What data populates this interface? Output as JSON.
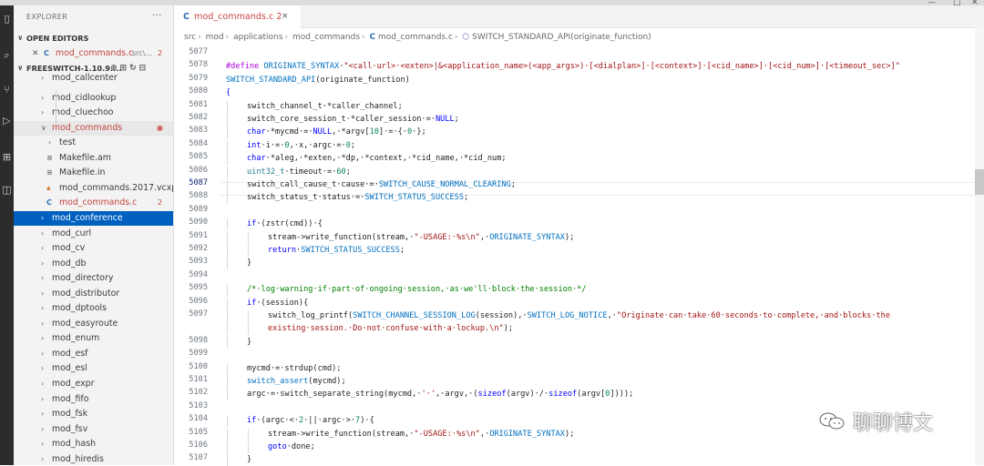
{
  "explorer": {
    "title": "EXPLORER",
    "more": "···",
    "open_editors_label": "OPEN EDITORS",
    "open_editor": {
      "name": "mod_commands.c",
      "path": "src\\...",
      "badge": "2"
    },
    "workspace_label": "FREESWITCH-1.10.9....",
    "tree": [
      {
        "label": "mod_callcenter",
        "indent": 1,
        "type": "folder"
      },
      {
        "label": "mod_cidlookup",
        "indent": 1,
        "type": "folder"
      },
      {
        "label": "mod_cluechoo",
        "indent": 1,
        "type": "folder"
      },
      {
        "label": "mod_commands",
        "indent": 1,
        "type": "folder-open",
        "state": "error"
      },
      {
        "label": "test",
        "indent": 2,
        "type": "folder"
      },
      {
        "label": "Makefile.am",
        "indent": 2,
        "type": "file"
      },
      {
        "label": "Makefile.in",
        "indent": 2,
        "type": "file"
      },
      {
        "label": "mod_commands.2017.vcxp...",
        "indent": 2,
        "type": "vcxproj"
      },
      {
        "label": "mod_commands.c",
        "indent": 2,
        "type": "c",
        "state": "error",
        "badge": "2"
      },
      {
        "label": "mod_conference",
        "indent": 1,
        "type": "folder",
        "state": "selected"
      },
      {
        "label": "mod_curl",
        "indent": 1,
        "type": "folder"
      },
      {
        "label": "mod_cv",
        "indent": 1,
        "type": "folder"
      },
      {
        "label": "mod_db",
        "indent": 1,
        "type": "folder"
      },
      {
        "label": "mod_directory",
        "indent": 1,
        "type": "folder"
      },
      {
        "label": "mod_distributor",
        "indent": 1,
        "type": "folder"
      },
      {
        "label": "mod_dptools",
        "indent": 1,
        "type": "folder"
      },
      {
        "label": "mod_easyroute",
        "indent": 1,
        "type": "folder"
      },
      {
        "label": "mod_enum",
        "indent": 1,
        "type": "folder"
      },
      {
        "label": "mod_esf",
        "indent": 1,
        "type": "folder"
      },
      {
        "label": "mod_esl",
        "indent": 1,
        "type": "folder"
      },
      {
        "label": "mod_expr",
        "indent": 1,
        "type": "folder"
      },
      {
        "label": "mod_fifo",
        "indent": 1,
        "type": "folder"
      },
      {
        "label": "mod_fsk",
        "indent": 1,
        "type": "folder"
      },
      {
        "label": "mod_fsv",
        "indent": 1,
        "type": "folder"
      },
      {
        "label": "mod_hash",
        "indent": 1,
        "type": "folder"
      },
      {
        "label": "mod_hiredis",
        "indent": 1,
        "type": "folder"
      }
    ]
  },
  "tab": {
    "icon": "C",
    "name": "mod_commands.c",
    "badge": "2",
    "close": "×"
  },
  "breadcrumb": [
    "src",
    "mod",
    "applications",
    "mod_commands",
    "mod_commands.c",
    "SWITCH_STANDARD_API(originate_function)"
  ],
  "breadcrumb_c_icon": "C",
  "code": {
    "current_line": "5087",
    "lines": [
      {
        "n": "5077",
        "ind": 0,
        "tokens": []
      },
      {
        "n": "5078",
        "ind": 0,
        "tokens": [
          [
            "pp",
            "#define "
          ],
          [
            "mac",
            "ORIGINATE_SYNTAX"
          ],
          [
            "",
            "·"
          ],
          [
            "str",
            "\"<call·url>·<exten>|&<application_name>(<app_args>)·[<dialplan>]·[<context>]·[<cid_name>]·[<cid_num>]·[<timeout_sec>]\""
          ]
        ]
      },
      {
        "n": "5079",
        "ind": 0,
        "tokens": [
          [
            "mac",
            "SWITCH_STANDARD_API"
          ],
          [
            "",
            "(originate_function)"
          ]
        ]
      },
      {
        "n": "5080",
        "ind": 0,
        "tokens": [
          [
            "kw",
            "{"
          ]
        ]
      },
      {
        "n": "5081",
        "ind": 1,
        "tokens": [
          [
            "",
            "switch_channel_t·*caller_channel;"
          ]
        ]
      },
      {
        "n": "5082",
        "ind": 1,
        "tokens": [
          [
            "",
            "switch_core_session_t·*caller_session·=·"
          ],
          [
            "kw",
            "NULL"
          ],
          [
            "",
            ";"
          ]
        ]
      },
      {
        "n": "5083",
        "ind": 1,
        "tokens": [
          [
            "kw",
            "char"
          ],
          [
            "",
            "·*mycmd·=·"
          ],
          [
            "kw",
            "NULL"
          ],
          [
            "",
            ",·*argv["
          ],
          [
            "num",
            "10"
          ],
          [
            "",
            "]·=·{·"
          ],
          [
            "num",
            "0"
          ],
          [
            "",
            "·};"
          ]
        ]
      },
      {
        "n": "5084",
        "ind": 1,
        "tokens": [
          [
            "kw",
            "int"
          ],
          [
            "",
            "·i·=·"
          ],
          [
            "num",
            "0"
          ],
          [
            "",
            ",·x,·argc·=·"
          ],
          [
            "num",
            "0"
          ],
          [
            "",
            ";"
          ]
        ]
      },
      {
        "n": "5085",
        "ind": 1,
        "tokens": [
          [
            "kw",
            "char"
          ],
          [
            "",
            "·*aleg,·*exten,·*dp,·*context,·*cid_name,·*cid_num;"
          ]
        ]
      },
      {
        "n": "5086",
        "ind": 1,
        "tokens": [
          [
            "typ",
            "uint32_t"
          ],
          [
            "",
            "·timeout·=·"
          ],
          [
            "num",
            "60"
          ],
          [
            "",
            ";"
          ]
        ]
      },
      {
        "n": "5087",
        "ind": 1,
        "tokens": [
          [
            "",
            "switch_call_cause_t·cause·=·"
          ],
          [
            "mac",
            "SWITCH_CAUSE_NORMAL_CLEARING"
          ],
          [
            "",
            ";"
          ]
        ]
      },
      {
        "n": "5088",
        "ind": 1,
        "tokens": [
          [
            "",
            "switch_status_t·status·=·"
          ],
          [
            "mac",
            "SWITCH_STATUS_SUCCESS"
          ],
          [
            "",
            ";"
          ]
        ]
      },
      {
        "n": "5089",
        "ind": 0,
        "tokens": []
      },
      {
        "n": "5090",
        "ind": 1,
        "tokens": [
          [
            "kw",
            "if"
          ],
          [
            "",
            "·(zstr(cmd))·{"
          ]
        ]
      },
      {
        "n": "5091",
        "ind": 2,
        "tokens": [
          [
            "",
            "stream->write_function(stream,·"
          ],
          [
            "str",
            "\"-USAGE:·%s\\n\""
          ],
          [
            "",
            ",·"
          ],
          [
            "mac",
            "ORIGINATE_SYNTAX"
          ],
          [
            "",
            ");"
          ]
        ]
      },
      {
        "n": "5092",
        "ind": 2,
        "tokens": [
          [
            "kw",
            "return"
          ],
          [
            "",
            "·"
          ],
          [
            "mac",
            "SWITCH_STATUS_SUCCESS"
          ],
          [
            "",
            ";"
          ]
        ]
      },
      {
        "n": "5093",
        "ind": 1,
        "tokens": [
          [
            "",
            "}"
          ]
        ]
      },
      {
        "n": "5094",
        "ind": 0,
        "tokens": []
      },
      {
        "n": "5095",
        "ind": 1,
        "tokens": [
          [
            "cm",
            "/*·log·warning·if·part·of·ongoing·session,·as·we'll·block·the·session·*/"
          ]
        ]
      },
      {
        "n": "5096",
        "ind": 1,
        "tokens": [
          [
            "kw",
            "if"
          ],
          [
            "",
            "·(session){"
          ]
        ]
      },
      {
        "n": "5097",
        "ind": 2,
        "tokens": [
          [
            "",
            "switch_log_printf("
          ],
          [
            "mac",
            "SWITCH_CHANNEL_SESSION_LOG"
          ],
          [
            "",
            "(session),·"
          ],
          [
            "mac",
            "SWITCH_LOG_NOTICE"
          ],
          [
            "",
            ",·"
          ],
          [
            "str",
            "\"Originate·can·take·60·seconds·to·complete,·and·blocks·the"
          ]
        ]
      },
      {
        "n": "",
        "ind": 2,
        "tokens": [
          [
            "str",
            "existing·session.·Do·not·confuse·with·a·lockup.\\n\""
          ],
          [
            "",
            ");"
          ]
        ]
      },
      {
        "n": "5098",
        "ind": 1,
        "tokens": [
          [
            "",
            "}"
          ]
        ]
      },
      {
        "n": "5099",
        "ind": 0,
        "tokens": []
      },
      {
        "n": "5100",
        "ind": 1,
        "tokens": [
          [
            "",
            "mycmd·=·strdup(cmd);"
          ]
        ]
      },
      {
        "n": "5101",
        "ind": 1,
        "tokens": [
          [
            "mac",
            "switch_assert"
          ],
          [
            "",
            "(mycmd);"
          ]
        ]
      },
      {
        "n": "5102",
        "ind": 1,
        "tokens": [
          [
            "",
            "argc·=·switch_separate_string(mycmd,·"
          ],
          [
            "str",
            "'·'"
          ],
          [
            "",
            ",·argv,·("
          ],
          [
            "kw",
            "sizeof"
          ],
          [
            "",
            "(argv)·/·"
          ],
          [
            "kw",
            "sizeof"
          ],
          [
            "",
            "(argv["
          ],
          [
            "num",
            "0"
          ],
          [
            "",
            "])));"
          ]
        ]
      },
      {
        "n": "5103",
        "ind": 0,
        "tokens": []
      },
      {
        "n": "5104",
        "ind": 1,
        "tokens": [
          [
            "kw",
            "if"
          ],
          [
            "",
            "·(argc·<·"
          ],
          [
            "num",
            "2"
          ],
          [
            "",
            "·||·argc·>·"
          ],
          [
            "num",
            "7"
          ],
          [
            "",
            ")·{"
          ]
        ]
      },
      {
        "n": "5105",
        "ind": 2,
        "tokens": [
          [
            "",
            "stream->write_function(stream,·"
          ],
          [
            "str",
            "\"-USAGE:·%s\\n\""
          ],
          [
            "",
            ",·"
          ],
          [
            "mac",
            "ORIGINATE_SYNTAX"
          ],
          [
            "",
            ");"
          ]
        ]
      },
      {
        "n": "5106",
        "ind": 2,
        "tokens": [
          [
            "kw",
            "goto"
          ],
          [
            "",
            "·done;"
          ]
        ]
      },
      {
        "n": "5107",
        "ind": 1,
        "tokens": [
          [
            "",
            "}"
          ]
        ]
      }
    ]
  },
  "watermark": "聊聊博文",
  "colors": {
    "selection": "#0060c0",
    "error": "#c2463f",
    "accent": "#2d6fb6"
  }
}
